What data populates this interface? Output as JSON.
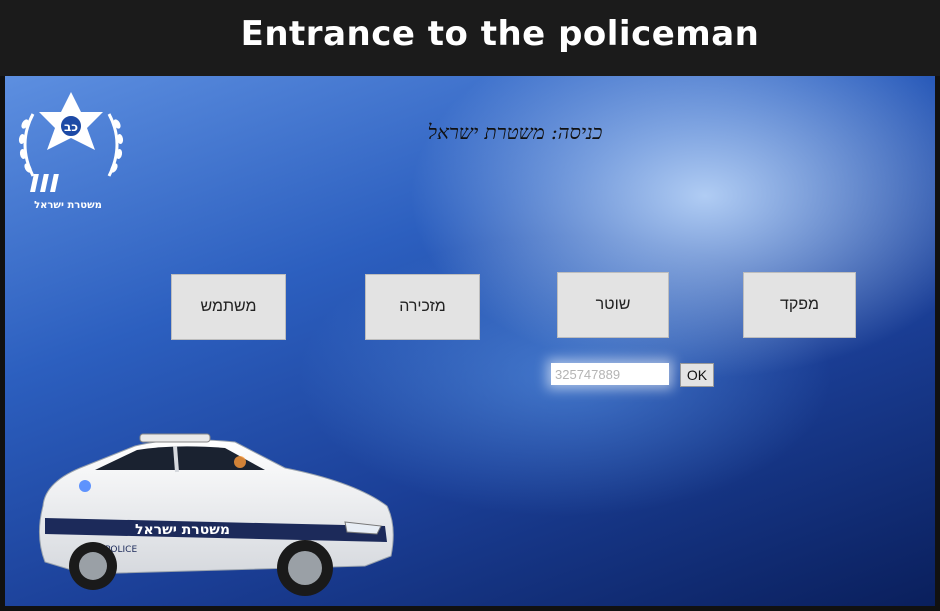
{
  "banner": {
    "title": "Entrance to the policeman"
  },
  "logo": {
    "caption": "משטרת ישראל",
    "emblem_text": "כב"
  },
  "heading": "כניסה: משטרת ישראל",
  "roles": {
    "user": "משתמש",
    "secretary": "מזכירה",
    "officer": "שוטר",
    "commander": "מפקד"
  },
  "login": {
    "id_value": "325747889",
    "ok_label": "OK"
  },
  "car": {
    "side_text": "משטרת ישראל",
    "police_text": "POLICE"
  },
  "colors": {
    "banner": "#1b1b1b",
    "button": "#e3e3e3",
    "background_dark": "#0a1f5c",
    "background_light": "#5d8fe0"
  }
}
